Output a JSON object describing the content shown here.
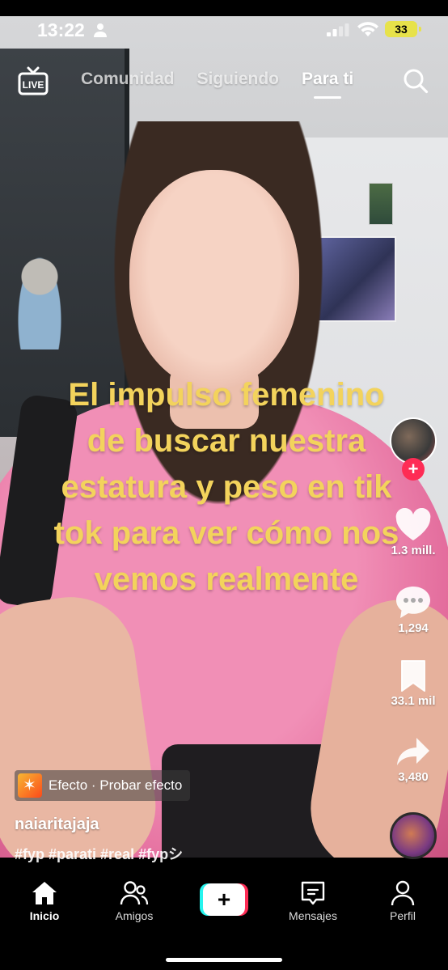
{
  "status_bar": {
    "time": "13:22",
    "battery": "33",
    "battery_color": "#e7e24a"
  },
  "top_nav": {
    "live_icon": "live-tv-icon",
    "tabs": [
      {
        "label": "Comunidad",
        "active": false
      },
      {
        "label": "Siguiendo",
        "active": false
      },
      {
        "label": "Para ti",
        "active": true
      }
    ],
    "search_icon": "search-icon"
  },
  "video": {
    "caption": "El impulso femenino de buscar nuestra estatura y peso en tik tok para ver cómo nos vemos realmente",
    "caption_color": "#f3d35c"
  },
  "actions": {
    "follow_label": "+",
    "like_count": "1.3 mill.",
    "comment_count": "1,294",
    "save_count": "33.1 mil",
    "share_count": "3,480"
  },
  "post": {
    "effect_label": "Efecto · Probar efecto",
    "username": "naiaritajaja",
    "hashtags": "#fyp #parati #real #fypシ"
  },
  "tab_bar": {
    "items": [
      {
        "label": "Inicio",
        "icon": "home-icon",
        "active": true
      },
      {
        "label": "Amigos",
        "icon": "friends-icon",
        "active": false
      },
      {
        "label": "+",
        "icon": "create-icon",
        "active": false
      },
      {
        "label": "Mensajes",
        "icon": "inbox-icon",
        "active": false
      },
      {
        "label": "Perfil",
        "icon": "profile-icon",
        "active": false
      }
    ]
  },
  "colors": {
    "accent_red": "#fe2c55",
    "accent_cyan": "#25f4ee"
  }
}
